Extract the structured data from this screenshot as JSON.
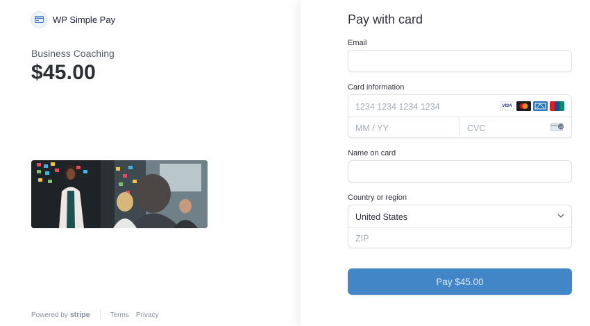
{
  "brand": {
    "name": "WP Simple Pay",
    "logo_icon": "credit-card-icon"
  },
  "product": {
    "name": "Business Coaching",
    "price": "$45.00",
    "image_icon": "team-meeting-photo"
  },
  "footer": {
    "powered_by": "Powered by",
    "stripe_word": "stripe",
    "terms": "Terms",
    "privacy": "Privacy"
  },
  "form": {
    "title": "Pay with card",
    "email": {
      "label": "Email",
      "value": ""
    },
    "card": {
      "label": "Card information",
      "number_placeholder": "1234 1234 1234 1234",
      "expiry_placeholder": "MM / YY",
      "cvc_placeholder": "CVC",
      "brands": [
        "VISA",
        "Mastercard",
        "American Express",
        "UnionPay"
      ]
    },
    "name": {
      "label": "Name on card",
      "value": ""
    },
    "country": {
      "label": "Country or region",
      "selected": "United States",
      "zip_placeholder": "ZIP"
    },
    "pay_label": "Pay $45.00"
  },
  "colors": {
    "pay_button": "#4286c8",
    "text_primary": "#30313d",
    "placeholder": "#a3acb9"
  }
}
